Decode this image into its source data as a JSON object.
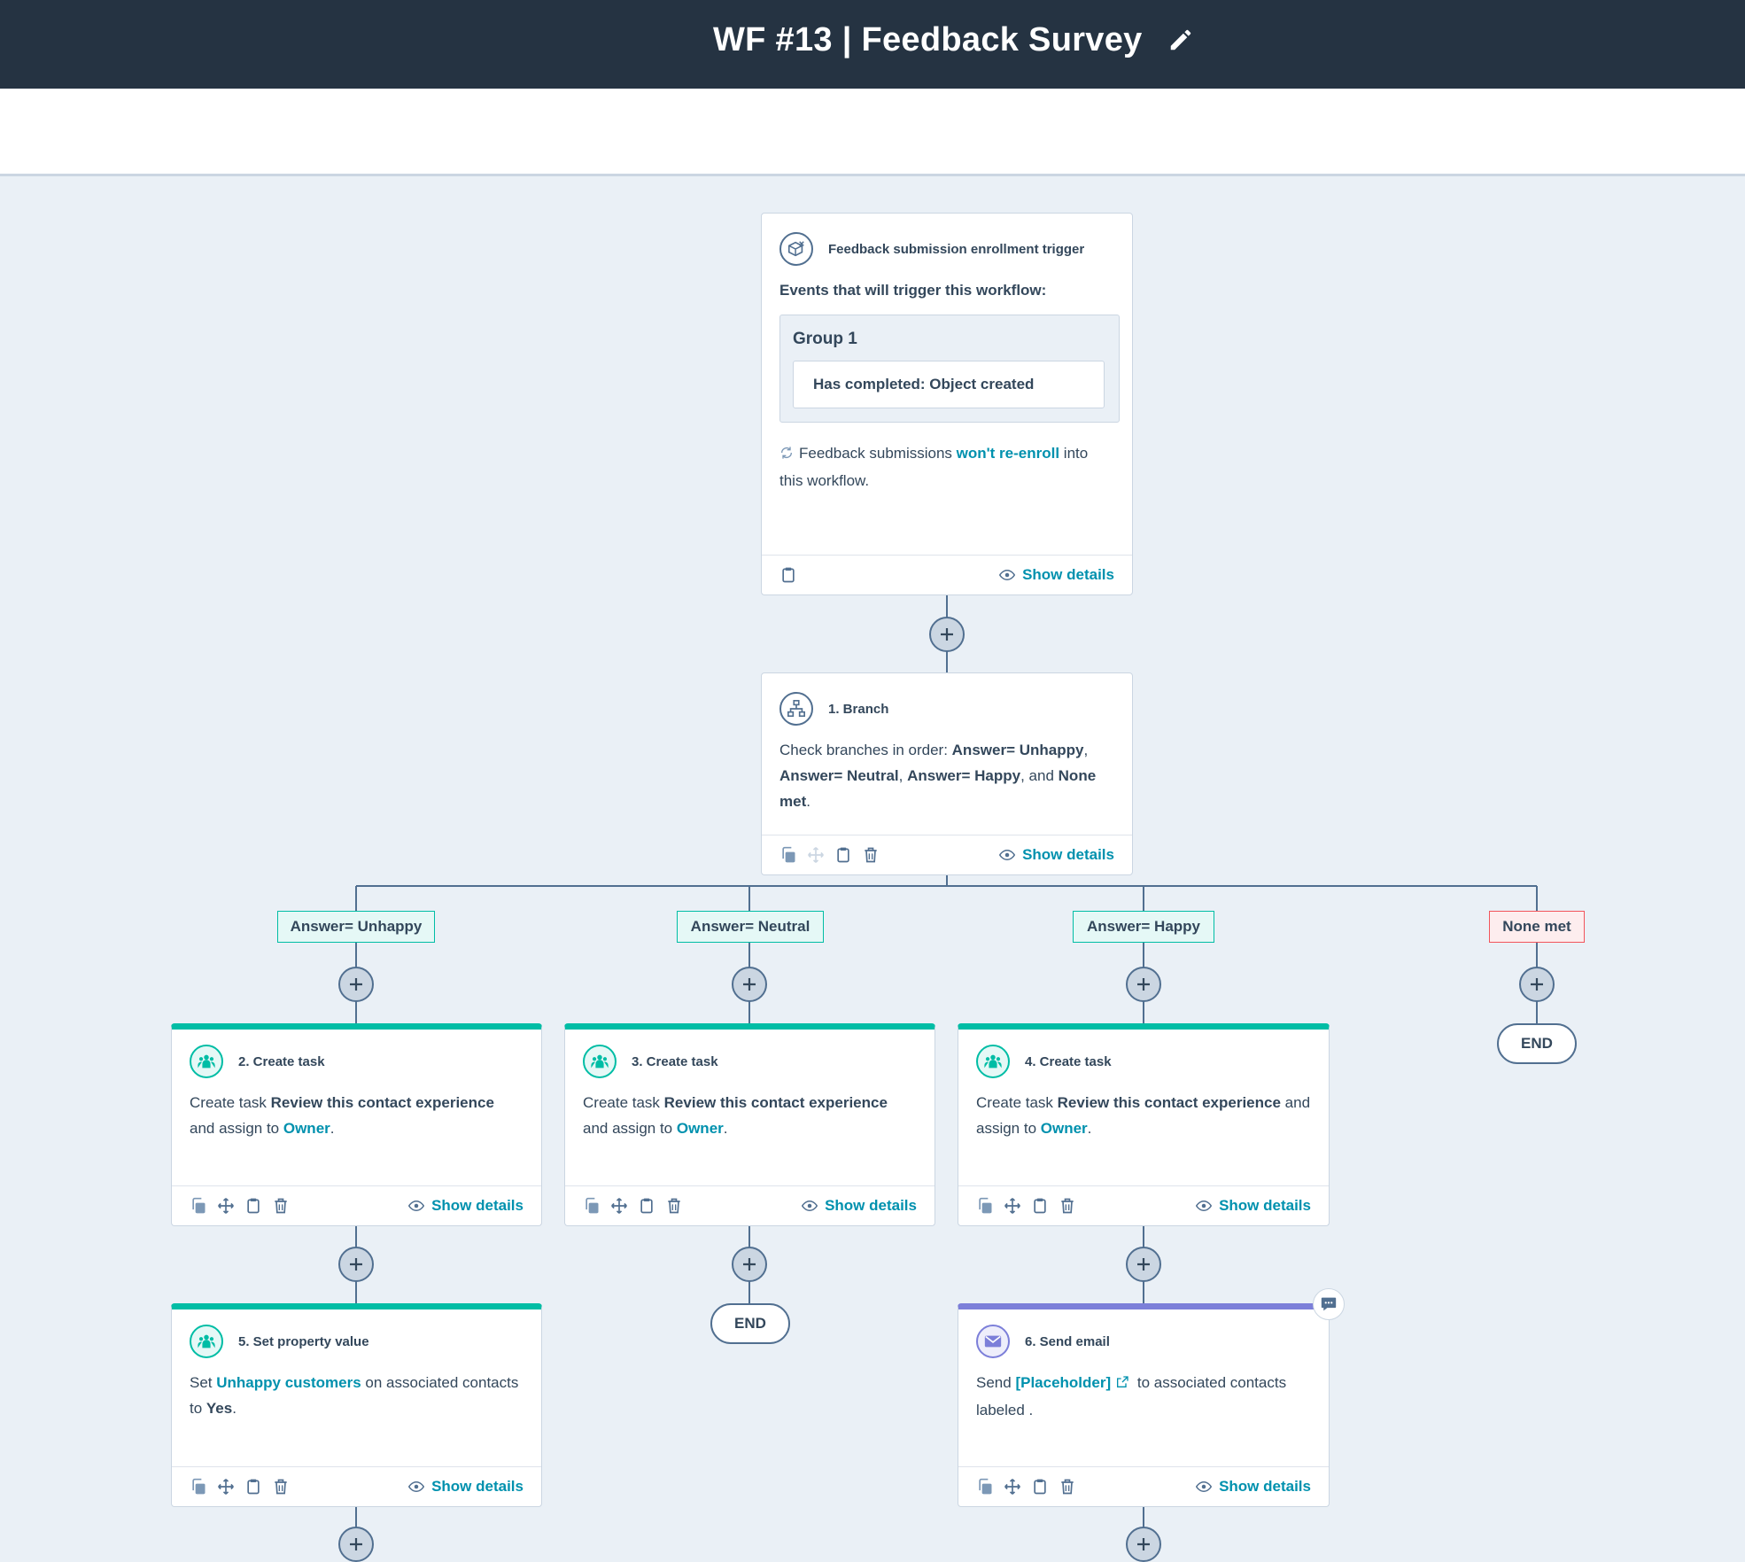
{
  "header": {
    "title": "WF #13 | Feedback Survey"
  },
  "trigger": {
    "title": "Feedback submission enrollment trigger",
    "events_label": "Events that will trigger this workflow:",
    "group_title": "Group 1",
    "condition": "Has completed: Object created",
    "reenroll_pre": "Feedback submissions ",
    "reenroll_link": "won't re-enroll",
    "reenroll_post": " into this workflow."
  },
  "branch": {
    "title": "1. Branch",
    "t1": "Check branches in order: ",
    "b1": "Answer= Unhappy",
    "t2": ", ",
    "b2": "Answer= Neutral",
    "t3": ", ",
    "b3": "Answer= Happy",
    "t4": ", and ",
    "b4": "None met",
    "t5": "."
  },
  "branch_labels": [
    "Answer= Unhappy",
    "Answer= Neutral",
    "Answer= Happy",
    "None met"
  ],
  "show_details": "Show details",
  "end_label": "END",
  "task_cards": [
    {
      "title": "2. Create task",
      "pre": "Create task ",
      "task": "Review this contact experience",
      "mid": " and assign to ",
      "owner": "Owner",
      "post": "."
    },
    {
      "title": "3. Create task",
      "pre": "Create task ",
      "task": "Review this contact experience",
      "mid": " and assign to ",
      "owner": "Owner",
      "post": "."
    },
    {
      "title": "4. Create task",
      "pre": "Create task ",
      "task": "Review this contact experience",
      "mid": " and assign to ",
      "owner": "Owner",
      "post": "."
    }
  ],
  "property_card": {
    "title": "5. Set property value",
    "pre": "Set ",
    "prop": "Unhappy customers",
    "mid": " on associated contacts to ",
    "value": "Yes",
    "post": "."
  },
  "email_card": {
    "title": "6. Send email",
    "pre": "Send ",
    "email": "[Placeholder]",
    "post": " to associated contacts labeled ."
  },
  "colors": {
    "header_bg": "#253342",
    "canvas_bg": "#eaf0f6",
    "teal": "#00bda5",
    "purple": "#7c7fd9",
    "link": "#0091ae",
    "line": "#516f90"
  },
  "icons": {
    "edit": "pencil-icon",
    "trigger": "feedback-icon",
    "branch": "branch-icon",
    "task": "people-icon",
    "email": "envelope-icon",
    "copy": "copy-icon",
    "move": "move-icon",
    "clipboard": "clipboard-icon",
    "delete": "trash-icon",
    "view": "eye-icon",
    "plus": "plus-icon",
    "refresh": "refresh-icon",
    "external": "external-link-icon",
    "comment": "comment-icon"
  }
}
